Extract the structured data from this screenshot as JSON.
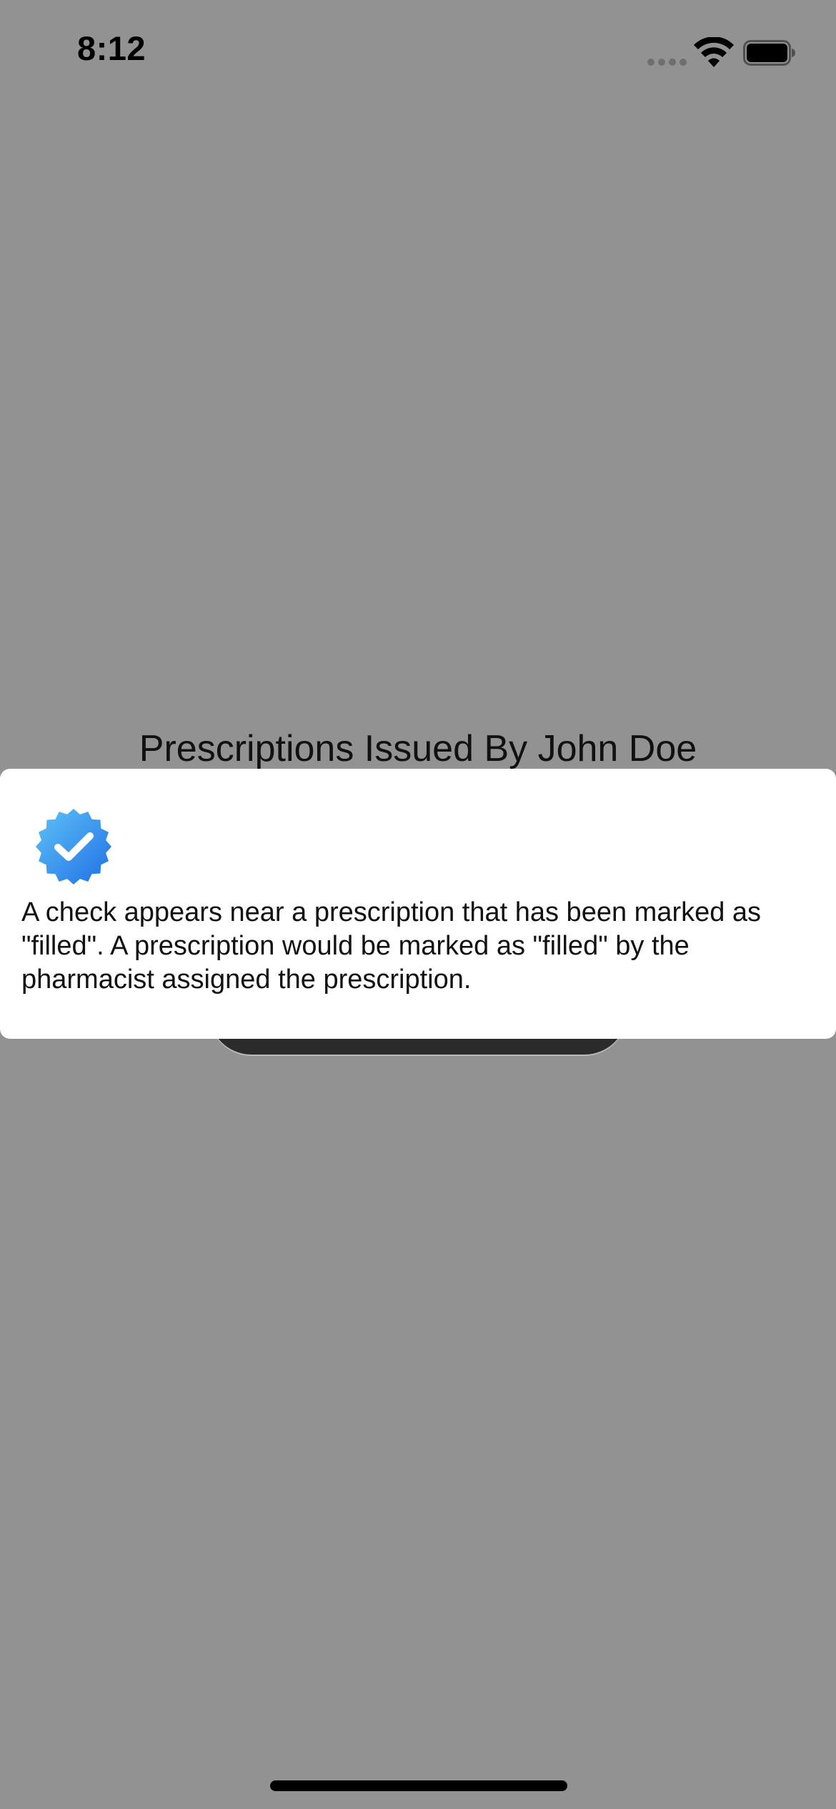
{
  "status_bar": {
    "time": "8:12"
  },
  "page": {
    "heading": "Prescriptions Issued By John Doe"
  },
  "info_sheet": {
    "icon": "verified-check-icon",
    "icon_color": "#2d8cf0",
    "message": "A check appears near a prescription that has been marked as \"filled\". A prescription would be marked as \"filled\" by the pharmacist assigned the prescription."
  },
  "colors": {
    "dim_background": "#929292",
    "sheet_background": "#ffffff",
    "button_dark": "#2c2b2b"
  }
}
